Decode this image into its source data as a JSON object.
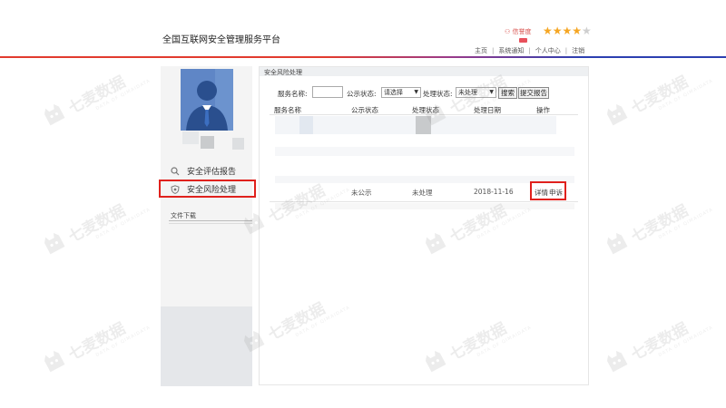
{
  "header": {
    "site_title": "全国互联网安全管理服务平台",
    "user_badge": "信誉度",
    "stars_on": "★★★★",
    "stars_off": "★",
    "links": [
      "主页",
      "系统通知",
      "个人中心",
      "注销"
    ],
    "accent_color": "#e23b2e"
  },
  "sidebar": {
    "menu": [
      {
        "label": "安全评估报告",
        "icon": "search-icon"
      },
      {
        "label": "安全风险处理",
        "icon": "shield-icon"
      }
    ],
    "file_download": "文件下载"
  },
  "main": {
    "title": "安全风险处理",
    "filters": {
      "service_name_label": "服务名称:",
      "public_status_label": "公示状态:",
      "public_status_value": "请选择",
      "process_status_label": "处理状态:",
      "process_status_value": "未处理",
      "search_button": "搜索",
      "submit_button": "提交报告"
    },
    "table": {
      "headers": [
        "服务名称",
        "公示状态",
        "处理状态",
        "处理日期",
        "操作"
      ],
      "rows": [
        {
          "service": "",
          "public_status": "未公示",
          "process_status": "未处理",
          "date": "2018-11-16",
          "actions": [
            "详情",
            "申诉"
          ]
        }
      ]
    }
  },
  "watermark": {
    "text": "七麦数据",
    "sub": "DATA OF QIMAIDATA"
  }
}
